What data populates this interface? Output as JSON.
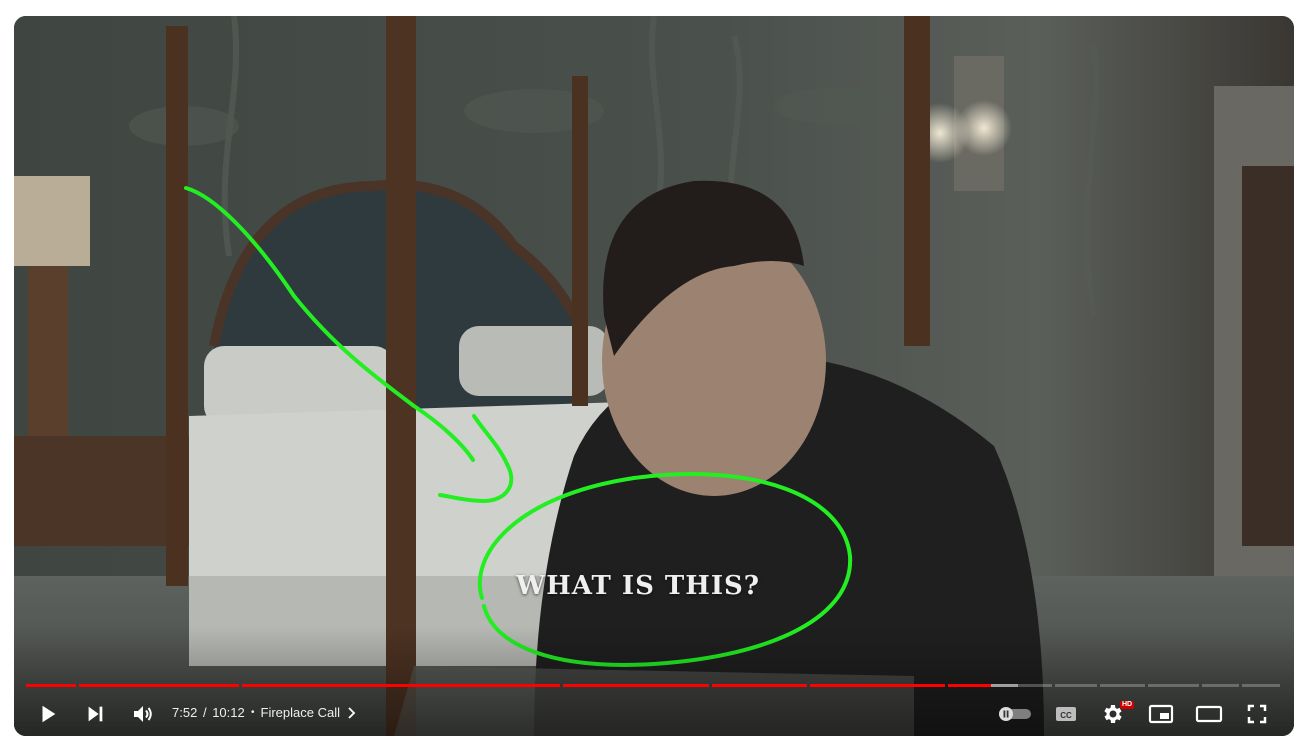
{
  "video": {
    "caption": "WHAT IS THIS?"
  },
  "progress": {
    "played_fraction": 0.768,
    "buffered_fraction": 0.79
  },
  "controls": {
    "play_icon": "play-icon",
    "next_icon": "next-icon",
    "volume_icon": "volume-icon",
    "current_time": "7:52",
    "time_separator": "/",
    "duration": "10:12",
    "chapter_dot": "•",
    "chapter_title": "Fireplace Call",
    "chapter_chevron_icon": "chevron-right-icon",
    "autoplay_icon": "autoplay-toggle-icon",
    "captions_icon": "captions-icon",
    "settings_icon": "settings-icon",
    "settings_badge": "HD",
    "miniplayer_icon": "miniplayer-icon",
    "theater_icon": "theater-mode-icon",
    "fullscreen_icon": "fullscreen-icon"
  },
  "colors": {
    "progress_played": "#ff0000",
    "annotation": "#22ee22",
    "hd_badge": "#cc0000"
  }
}
